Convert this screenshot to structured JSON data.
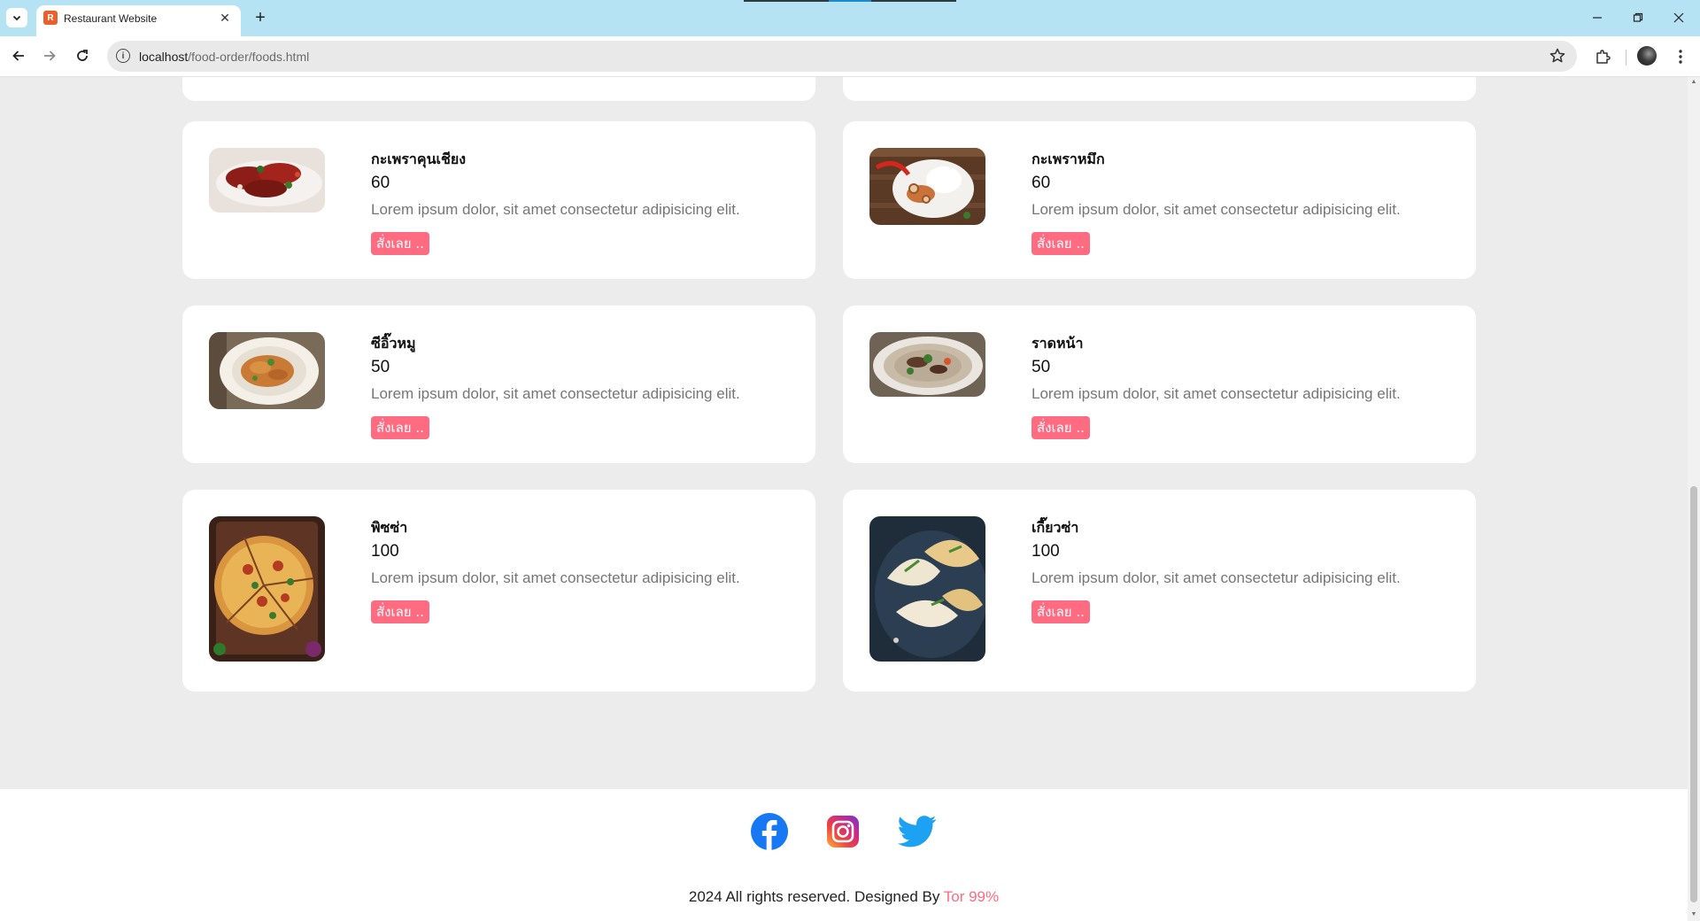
{
  "browser": {
    "tab_title": "Restaurant Website",
    "url_host": "localhost",
    "url_path": "/food-order/foods.html"
  },
  "colors": {
    "accent": "#ff6b81",
    "page_bg": "#ececec",
    "tabbar_bg": "#b6e3f3",
    "facebook": "#1877f2",
    "twitter": "#1da1f2"
  },
  "foods": [
    {
      "name": "กะเพราคุนเชียง",
      "price": "60",
      "description": "Lorem ipsum dolor, sit amet consectetur adipisicing elit.",
      "order_label": "สั่งเลย ..",
      "image": "stir-fried-pork-on-rice"
    },
    {
      "name": "กะเพราหมึก",
      "price": "60",
      "description": "Lorem ipsum dolor, sit amet consectetur adipisicing elit.",
      "order_label": "สั่งเลย ..",
      "image": "squid-basil-with-rice"
    },
    {
      "name": "ซีอิ๊วหมู",
      "price": "50",
      "description": "Lorem ipsum dolor, sit amet consectetur adipisicing elit.",
      "order_label": "สั่งเลย ..",
      "image": "pad-see-ew-pork"
    },
    {
      "name": "ราดหน้า",
      "price": "50",
      "description": "Lorem ipsum dolor, sit amet consectetur adipisicing elit.",
      "order_label": "สั่งเลย ..",
      "image": "rad-na-gravy-noodles"
    },
    {
      "name": "พิซซ่า",
      "price": "100",
      "description": "Lorem ipsum dolor, sit amet consectetur adipisicing elit.",
      "order_label": "สั่งเลย ..",
      "image": "pizza"
    },
    {
      "name": "เกี๊ยวซ่า",
      "price": "100",
      "description": "Lorem ipsum dolor, sit amet consectetur adipisicing elit.",
      "order_label": "สั่งเลย ..",
      "image": "gyoza-dumplings"
    }
  ],
  "footer": {
    "social_icons": [
      "facebook-icon",
      "instagram-icon",
      "twitter-icon"
    ],
    "copyright_text": "2024 All rights reserved. Designed By ",
    "designer": "Tor 99%"
  }
}
